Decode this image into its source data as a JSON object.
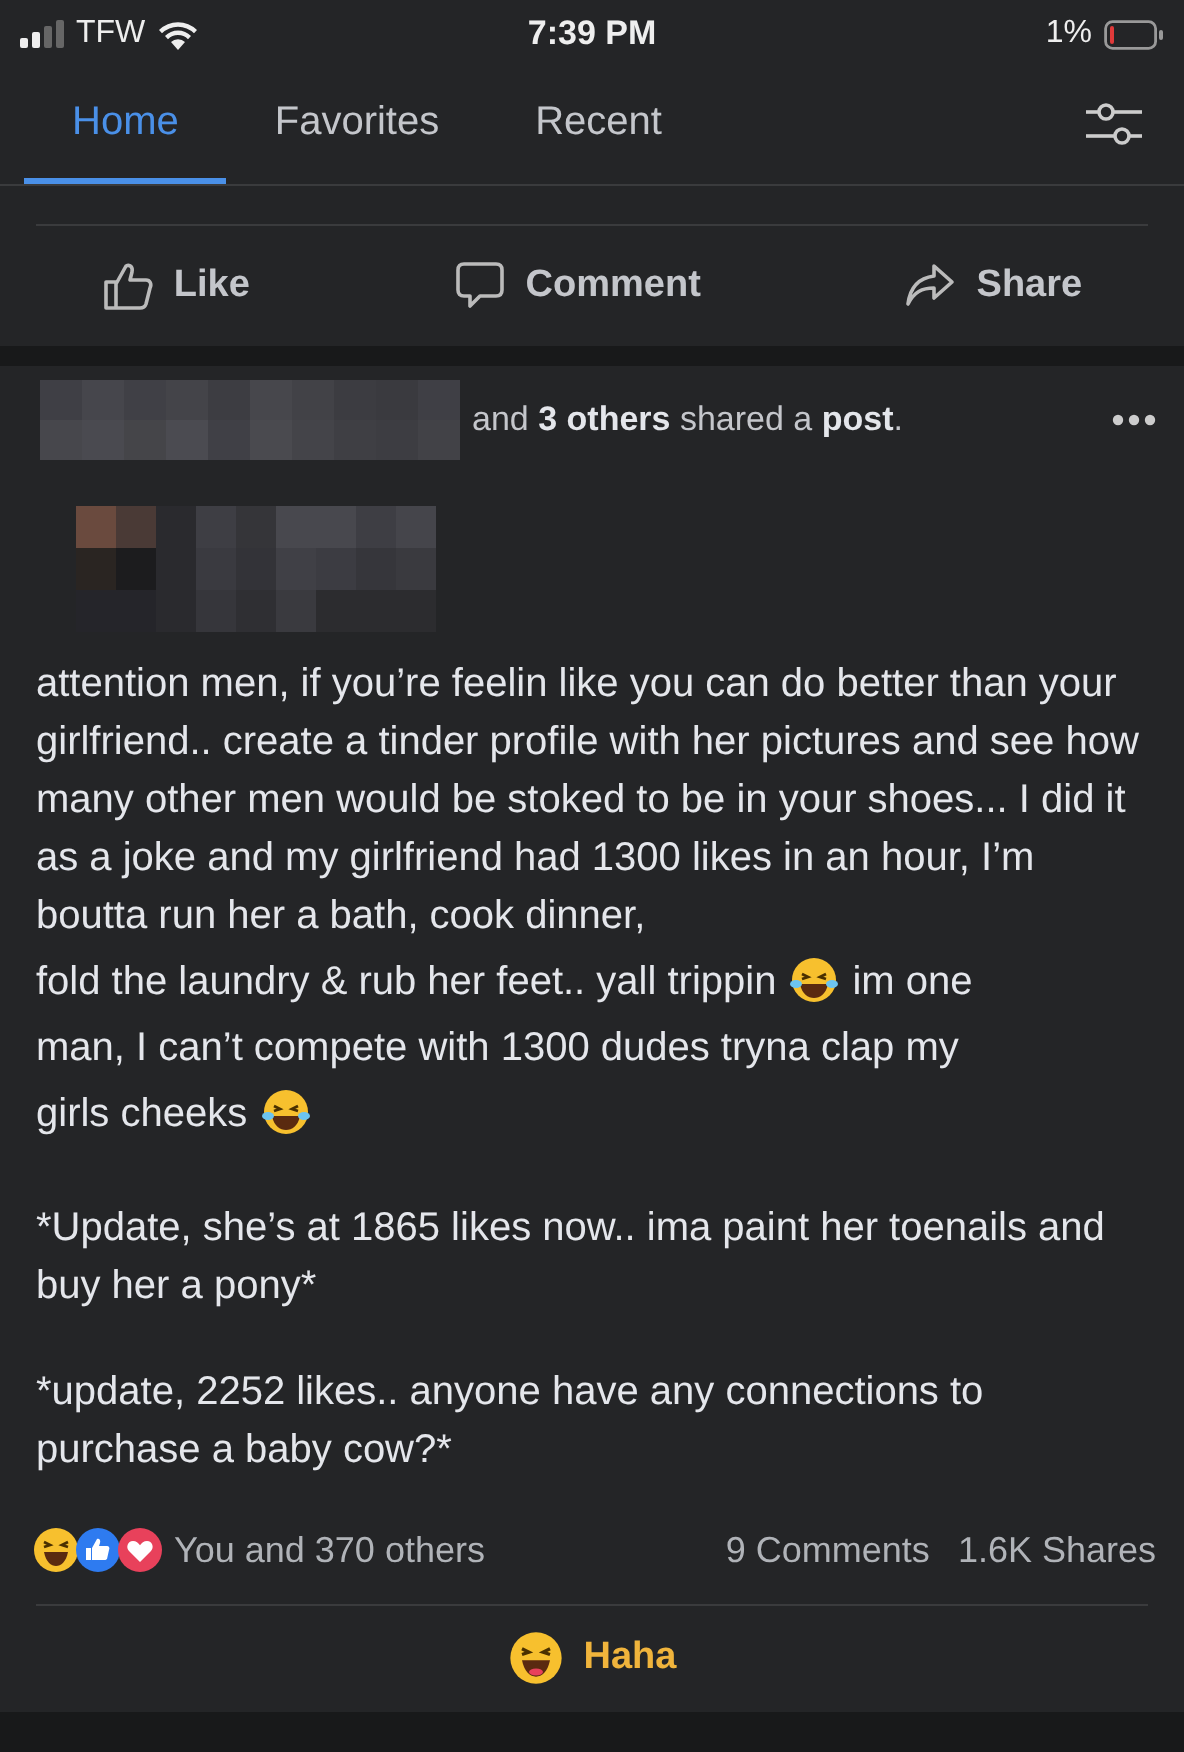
{
  "status_bar": {
    "carrier": "TFW",
    "time": "7:39 PM",
    "battery": "1%"
  },
  "tabs": [
    {
      "label": "Home",
      "selected": true
    },
    {
      "label": "Favorites",
      "selected": false
    },
    {
      "label": "Recent",
      "selected": false
    }
  ],
  "actions": [
    {
      "kind": "like",
      "label": "Like"
    },
    {
      "kind": "comment",
      "label": "Comment"
    },
    {
      "kind": "share",
      "label": "Share"
    }
  ],
  "shared_header": {
    "text": "and **3 others** shared a **post**."
  },
  "post": {
    "paragraphs": [
      [
        [
          {
            "kind": "text",
            "text": "attention men, if you’re feelin like you can do better than your girlfriend.. create a tinder profile with her pictures and see how many other men would be stoked to be in your shoes... I did it as a joke and my girlfriend had 1300 likes in an hour, I’m boutta run her a bath, cook dinner,"
          }
        ],
        [
          {
            "kind": "text",
            "text": "fold the laundry & rub her feet.. yall trippin"
          },
          {
            "kind": "emoji"
          },
          {
            "kind": "text",
            "text": "im one"
          }
        ],
        [
          {
            "kind": "text",
            "text": "man, I can’t compete with 1300 dudes tryna clap my"
          }
        ],
        [
          {
            "kind": "text",
            "text": "girls cheeks"
          },
          {
            "kind": "emoji"
          }
        ]
      ],
      [
        [
          {
            "kind": "text",
            "text": "*Update, she’s at 1865 likes now.. ima paint her toenails and buy her a pony*"
          }
        ]
      ],
      [
        [
          {
            "kind": "text",
            "text": "*update, 2252 likes.. anyone have any connections to purchase a baby cow?*"
          }
        ]
      ]
    ],
    "reactions": {
      "summary": "You and 370 others",
      "comments": "9 Comments",
      "shares": "1.6K Shares"
    },
    "my_reaction": {
      "kind": "haha",
      "label": "Haha"
    }
  }
}
